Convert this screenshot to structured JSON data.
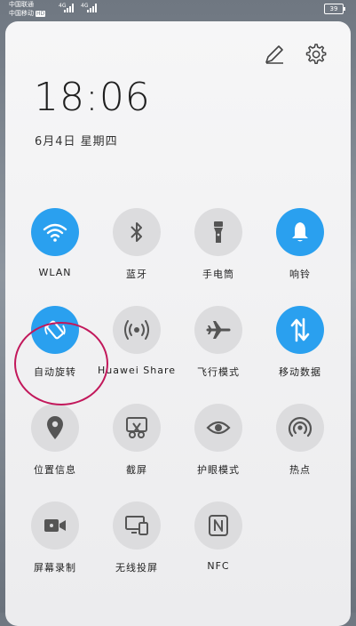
{
  "status_bar": {
    "carrier_1": "中国联通",
    "carrier_2": "中国移动",
    "hd_badge": "HD",
    "network_1": "4G",
    "network_2": "4G",
    "battery_level": "39"
  },
  "header": {
    "time": "18:06",
    "date": "6月4日 星期四",
    "edit_icon": "pencil-icon",
    "settings_icon": "gear-icon"
  },
  "tiles": [
    {
      "id": "wlan",
      "label": "WLAN",
      "icon": "wifi-icon",
      "active": true
    },
    {
      "id": "bluetooth",
      "label": "蓝牙",
      "icon": "bluetooth-icon",
      "active": false
    },
    {
      "id": "flashlight",
      "label": "手电筒",
      "icon": "flashlight-icon",
      "active": false
    },
    {
      "id": "ringer",
      "label": "响铃",
      "icon": "bell-icon",
      "active": true
    },
    {
      "id": "auto_rotate",
      "label": "自动旋转",
      "icon": "rotate-icon",
      "active": true
    },
    {
      "id": "huawei_share",
      "label": "Huawei Share",
      "icon": "share-signal-icon",
      "active": false
    },
    {
      "id": "airplane",
      "label": "飞行模式",
      "icon": "airplane-icon",
      "active": false
    },
    {
      "id": "mobile_data",
      "label": "移动数据",
      "icon": "data-arrows-icon",
      "active": true
    },
    {
      "id": "location",
      "label": "位置信息",
      "icon": "location-pin-icon",
      "active": false
    },
    {
      "id": "screenshot",
      "label": "截屏",
      "icon": "screenshot-scissors-icon",
      "active": false
    },
    {
      "id": "eye_comfort",
      "label": "护眼模式",
      "icon": "eye-icon",
      "active": false
    },
    {
      "id": "hotspot",
      "label": "热点",
      "icon": "hotspot-icon",
      "active": false
    },
    {
      "id": "screen_record",
      "label": "屏幕录制",
      "icon": "video-camera-icon",
      "active": false
    },
    {
      "id": "wireless_projection",
      "label": "无线投屏",
      "icon": "projection-icon",
      "active": false
    },
    {
      "id": "nfc",
      "label": "NFC",
      "icon": "nfc-icon",
      "active": false
    }
  ],
  "colors": {
    "active": "#2aa0ef",
    "inactive": "#dcdcde",
    "highlight_ring": "#c2185b"
  }
}
